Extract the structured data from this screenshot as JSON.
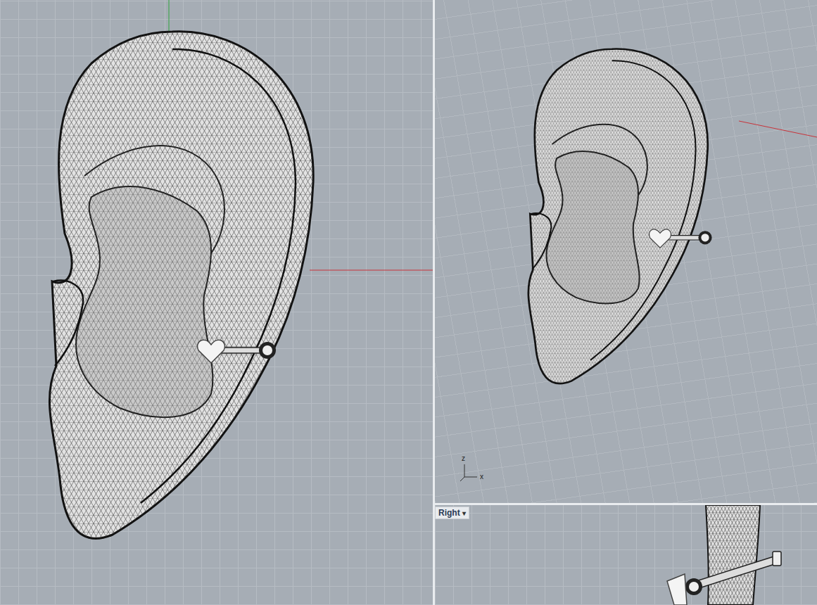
{
  "viewport_label": {
    "text": "Right",
    "menu_icon": "▾"
  },
  "axis_widget": {
    "labels": [
      "z",
      "x"
    ]
  }
}
